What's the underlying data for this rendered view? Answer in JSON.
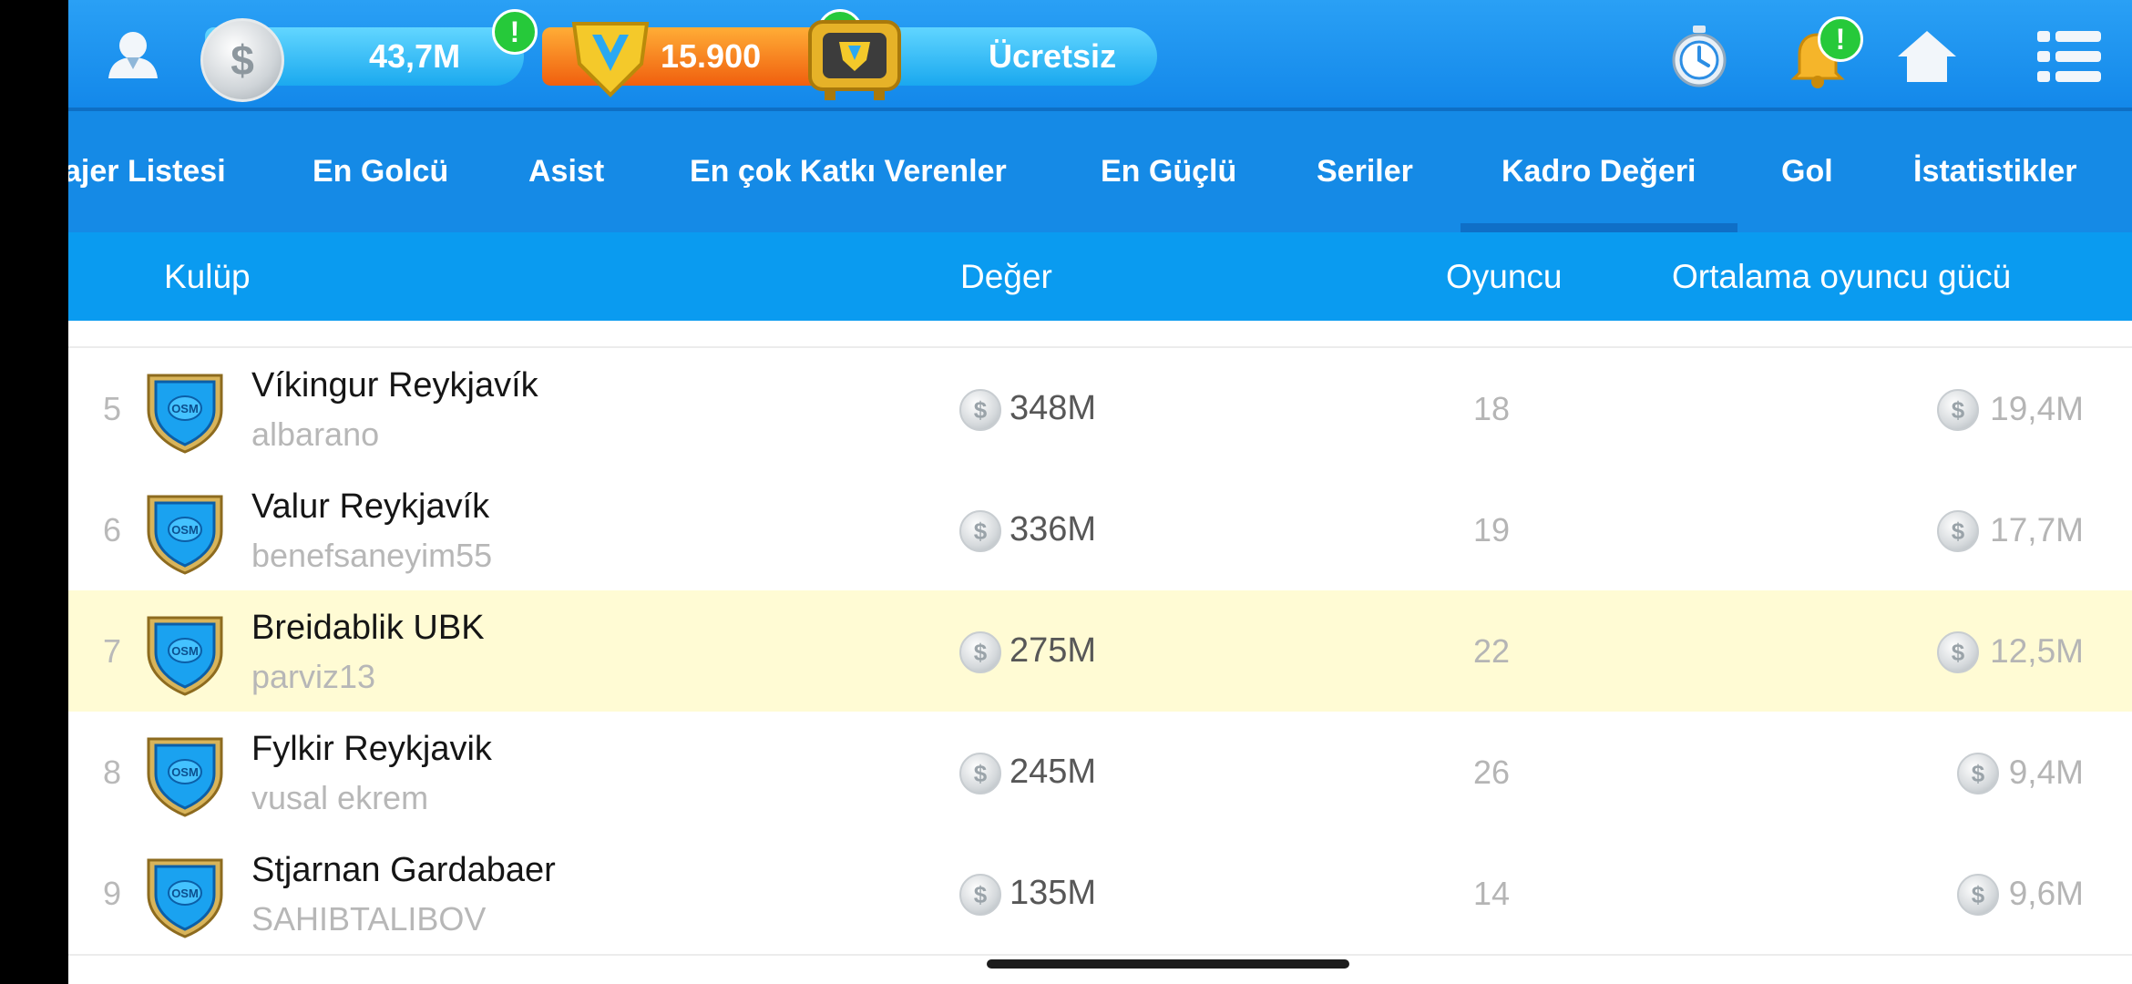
{
  "topbar": {
    "coins": "43,7M",
    "gold": "15.900",
    "gold_plus": "+",
    "free_label": "Ücretsiz",
    "alert_mark": "!",
    "coin_symbol": "$"
  },
  "tabs": [
    {
      "label": "ajer Listesi"
    },
    {
      "label": "En Golcü"
    },
    {
      "label": "Asist"
    },
    {
      "label": "En çok Katkı Verenler"
    },
    {
      "label": "En Güçlü"
    },
    {
      "label": "Seriler"
    },
    {
      "label": "Kadro Değeri",
      "active": true
    },
    {
      "label": "Gol"
    },
    {
      "label": "İstatistikler"
    }
  ],
  "columns": {
    "club": "Kulüp",
    "value": "Değer",
    "players": "Oyuncu",
    "avg_strength": "Ortalama oyuncu gücü"
  },
  "badge_text": "OSM",
  "rows": [
    {
      "rank": "5",
      "club": "Víkingur Reykjavík",
      "manager": "albarano",
      "value": "348M",
      "players": "18",
      "avg": "19,4M"
    },
    {
      "rank": "6",
      "club": "Valur Reykjavík",
      "manager": "benefsaneyim55",
      "value": "336M",
      "players": "19",
      "avg": "17,7M"
    },
    {
      "rank": "7",
      "club": "Breidablik UBK",
      "manager": "parviz13",
      "value": "275M",
      "players": "22",
      "avg": "12,5M",
      "highlighted": true
    },
    {
      "rank": "8",
      "club": "Fylkir Reykjavik",
      "manager": "vusal ekrem",
      "value": "245M",
      "players": "26",
      "avg": "9,4M"
    },
    {
      "rank": "9",
      "club": "Stjarnan Gardabaer",
      "manager": "SAHIBTALIBOV",
      "value": "135M",
      "players": "14",
      "avg": "9,6M"
    }
  ],
  "colors": {
    "topbar": "#1a94ee",
    "tabbar": "#158ae6",
    "header": "#0a9bf0",
    "highlight_row": "#fffbd4",
    "alert": "#26c93a"
  },
  "icons": [
    "user-icon",
    "coin-icon",
    "gold-token-icon",
    "tv-icon",
    "stopwatch-icon",
    "bell-icon",
    "home-icon",
    "menu-icon",
    "club-badge-icon"
  ]
}
